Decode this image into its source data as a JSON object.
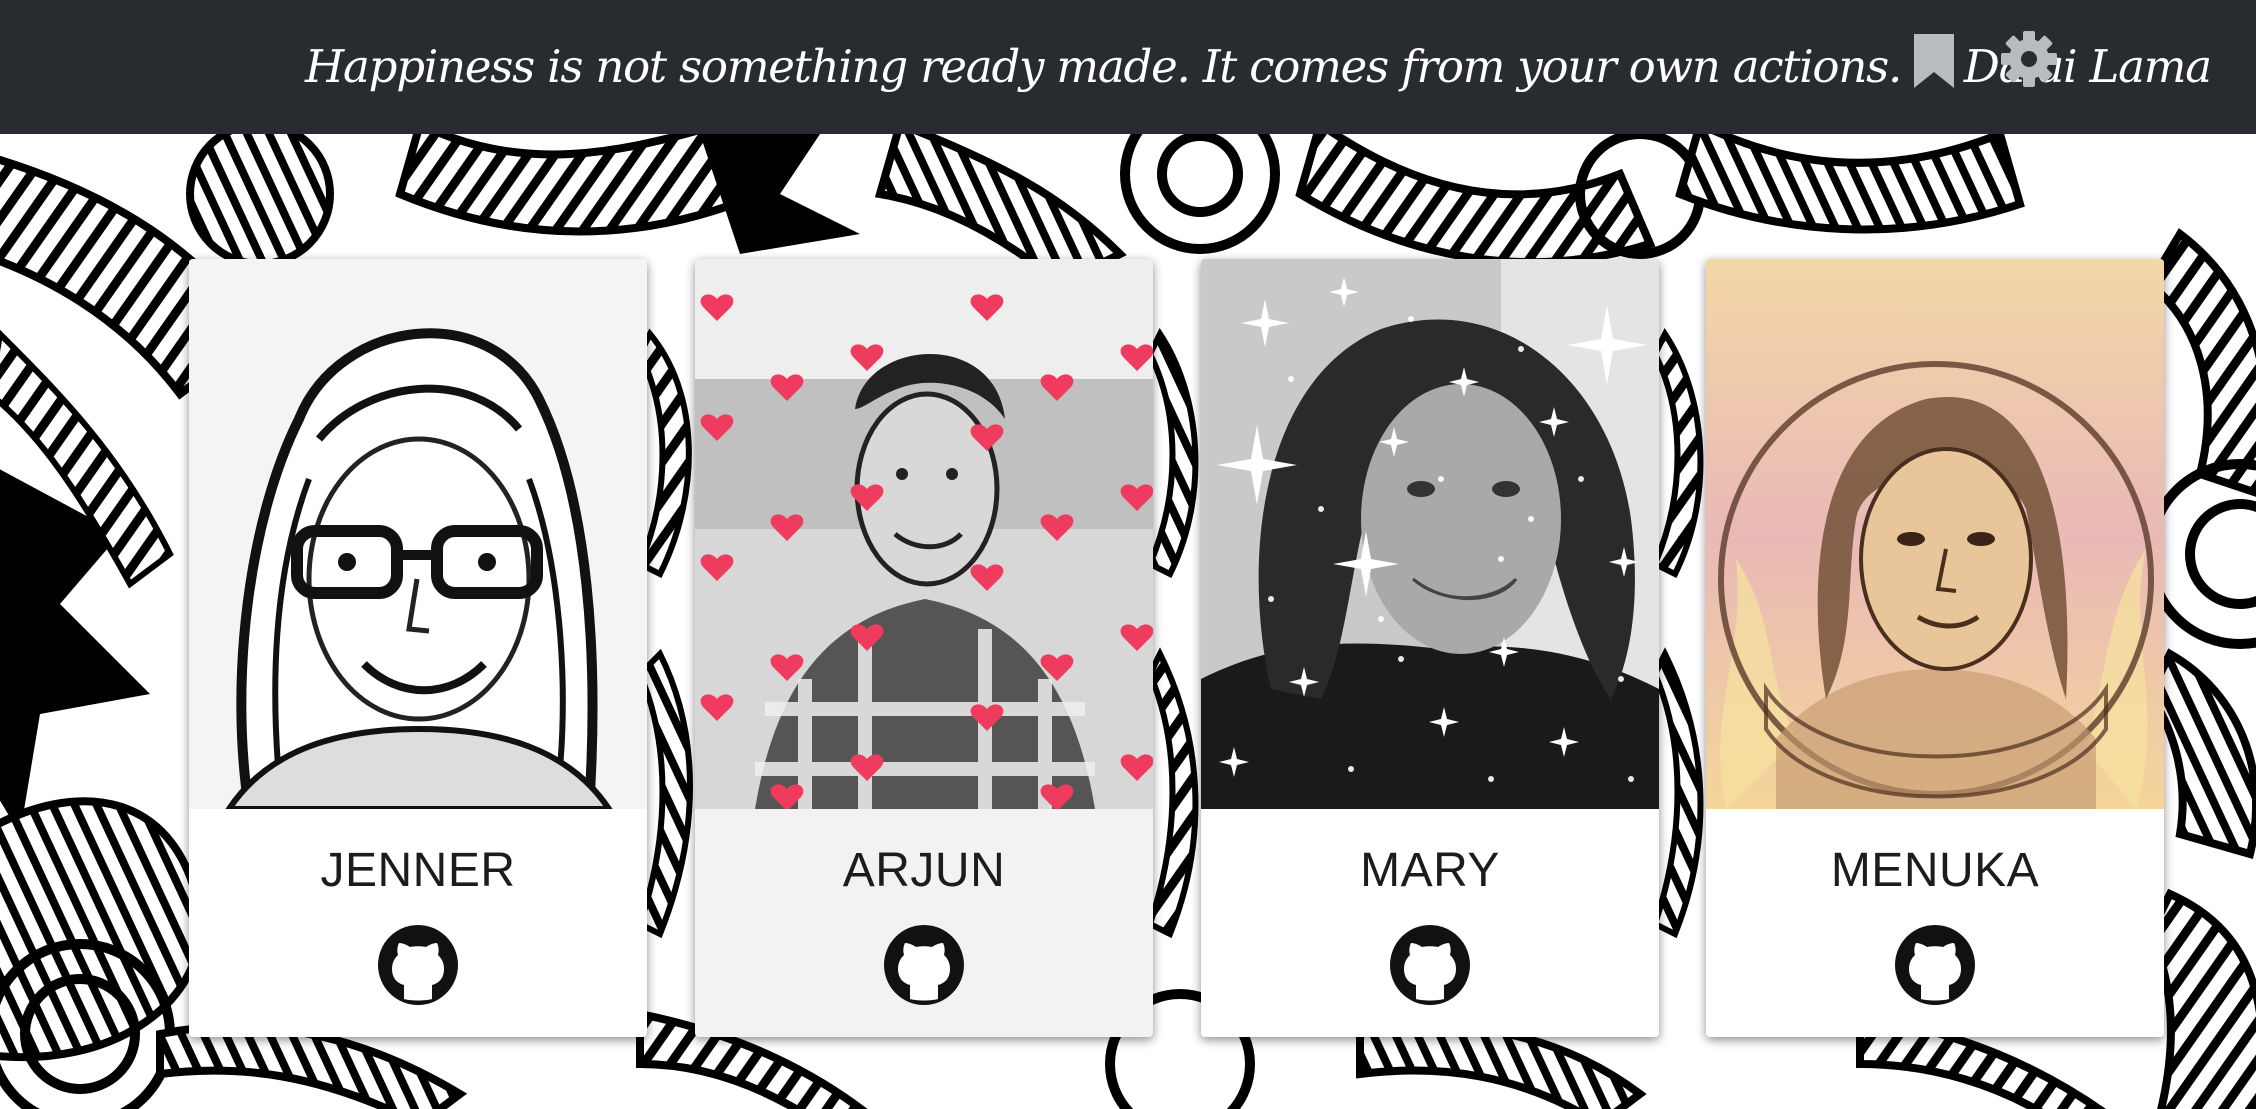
{
  "header": {
    "quote": "Happiness is not something ready made. It comes from your own actions. ~ Dalai Lama",
    "bookmark_icon": "bookmark-icon",
    "settings_icon": "gear-icon",
    "background_color": "#282c30"
  },
  "team": [
    {
      "name": "JENNER",
      "photo_style": "sketch",
      "link_icon": "github-icon"
    },
    {
      "name": "ARJUN",
      "photo_style": "hearts",
      "link_icon": "github-icon"
    },
    {
      "name": "MARY",
      "photo_style": "sparkles",
      "link_icon": "github-icon"
    },
    {
      "name": "MENUKA",
      "photo_style": "flames",
      "link_icon": "github-icon"
    }
  ]
}
